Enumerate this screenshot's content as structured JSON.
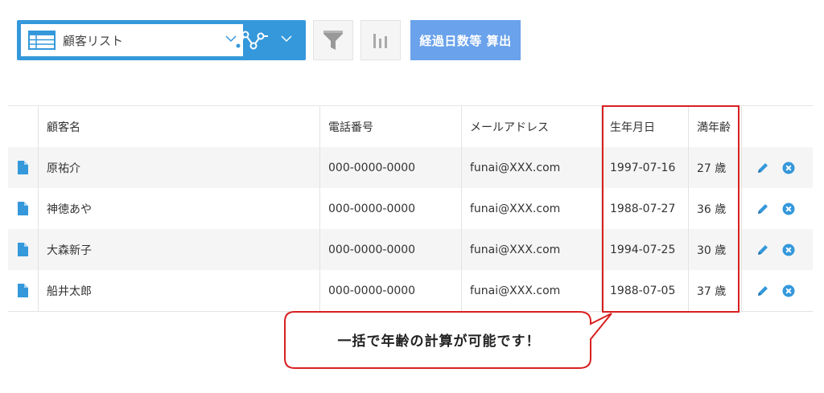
{
  "toolbar": {
    "view_name": "顧客リスト",
    "calc_button_label": "経過日数等 算出",
    "accent_color": "#3498db",
    "calc_button_color": "#6aa2eb"
  },
  "table": {
    "headers": [
      "顧客名",
      "電話番号",
      "メールアドレス",
      "生年月日",
      "満年齢"
    ],
    "rows": [
      {
        "name": "原祐介",
        "phone": "000-0000-0000",
        "email": "funai@XXX.com",
        "birthdate": "1997-07-16",
        "age": "27 歳"
      },
      {
        "name": "神徳あや",
        "phone": "000-0000-0000",
        "email": "funai@XXX.com",
        "birthdate": "1988-07-27",
        "age": "36 歳"
      },
      {
        "name": "大森新子",
        "phone": "000-0000-0000",
        "email": "funai@XXX.com",
        "birthdate": "1994-07-25",
        "age": "30 歳"
      },
      {
        "name": "船井太郎",
        "phone": "000-0000-0000",
        "email": "funai@XXX.com",
        "birthdate": "1988-07-05",
        "age": "37 歳"
      }
    ]
  },
  "callout": {
    "text": "一括で年齢の計算が可能です！",
    "border_color": "#d92020"
  },
  "icons": {
    "view_icon": "table-list-icon",
    "graph_icon": "graph-icon",
    "filter_icon": "funnel-icon",
    "chart_icon": "bar-chart-icon",
    "record_icon": "document-icon",
    "edit_icon": "pencil-icon",
    "delete_icon": "close-circle-icon"
  }
}
